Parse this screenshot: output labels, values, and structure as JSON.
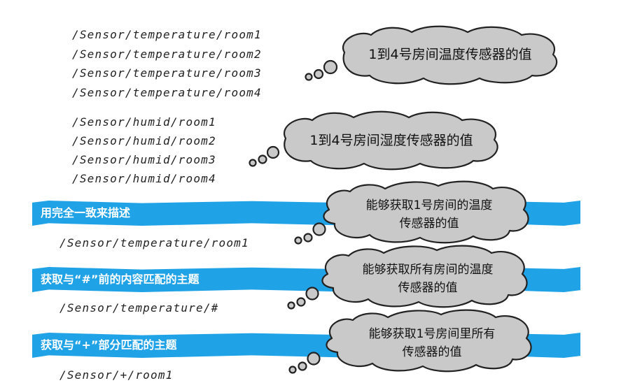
{
  "temperature_topics": [
    "/Sensor/temperature/room1",
    "/Sensor/temperature/room2",
    "/Sensor/temperature/room3",
    "/Sensor/temperature/room4"
  ],
  "humid_topics": [
    "/Sensor/humid/room1",
    "/Sensor/humid/room2",
    "/Sensor/humid/room3",
    "/Sensor/humid/room4"
  ],
  "bubbles": {
    "temperature_all": "1到4号房间温度传感器的值",
    "humid_all": "1到4号房间湿度传感器的值"
  },
  "sections": [
    {
      "header": "用完全一致来描述",
      "topic": "/Sensor/temperature/room1",
      "bubble_line1": "能够获取1号房间的温度",
      "bubble_line2": "传感器的值"
    },
    {
      "header": "获取与“#”前的内容匹配的主题",
      "topic": "/Sensor/temperature/#",
      "bubble_line1": "能够获取所有房间的温度",
      "bubble_line2": "传感器的值"
    },
    {
      "header": "获取与“+”部分匹配的主题",
      "topic": "/Sensor/+/room1",
      "bubble_line1": "能够获取1号房间里所有",
      "bubble_line2": "传感器的值"
    }
  ],
  "colors": {
    "band": "#1fa2e6",
    "cloud": "#c9c9c9",
    "outline": "#222222"
  }
}
